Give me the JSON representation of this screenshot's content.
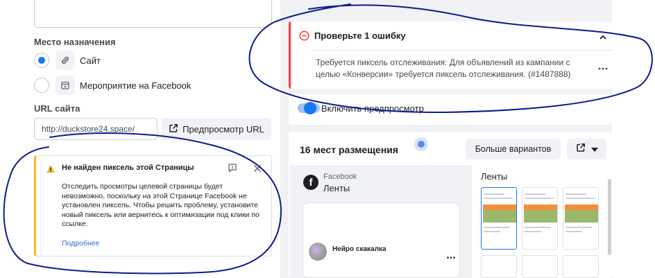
{
  "left": {
    "destination_label": "Место назначения",
    "options": [
      {
        "label": "Сайт",
        "selected": true,
        "icon": "link-icon"
      },
      {
        "label": "Мероприятие на Facebook",
        "selected": false,
        "icon": "calendar-star-icon"
      }
    ],
    "url_label": "URL сайта",
    "url_value": "http://duckstore24.space/",
    "preview_url_button": "Предпросмотр URL",
    "warning": {
      "title": "Не найден пиксель этой Страницы",
      "body": "Отследить просмотры целевой страницы будет невозможно, поскольку на этой Странице Facebook не установлен пиксель. Чтобы решить проблему, установите новый пиксель или вернитесь к оптимизации под клики по ссылке.",
      "link": "Подробнее"
    }
  },
  "right": {
    "error": {
      "title": "Проверьте 1 ошибку",
      "body": "Требуется пиксель отслеживания: Для объявлений из кампании с целью «Конверсии» требуется пиксель отслеживания. (#1487888)"
    },
    "preview_toggle_label": "Включить предпросмотр",
    "placements": {
      "title": "16 мест размещения",
      "more_button": "Больше вариантов",
      "platform": "Facebook",
      "feed_label": "Ленты",
      "right_feed_label": "Ленты",
      "post_author": "Нейро скакалка"
    }
  },
  "colors": {
    "accent": "#1877f2",
    "error": "#fa383e",
    "warning": "#f7b928",
    "link": "#216fdb",
    "annotation": "#0b1a8f"
  }
}
